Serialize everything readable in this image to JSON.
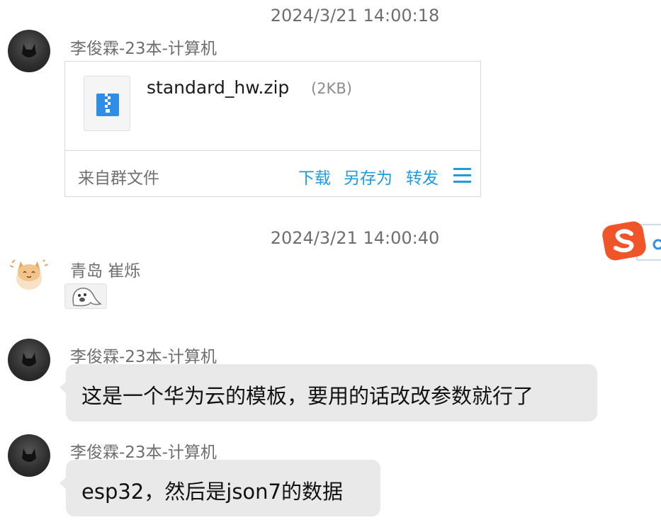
{
  "messages": [
    {
      "timestamp": "2024/3/21 14:00:18",
      "sender": "李俊霖-23本-计算机",
      "file": {
        "name": "standard_hw.zip",
        "size": "(2KB)",
        "source": "来自群文件",
        "actions": [
          "下载",
          "另存为",
          "转发"
        ]
      }
    },
    {
      "timestamp": "2024/3/21 14:00:40",
      "sender": "青岛 崔烁"
    },
    {
      "sender": "李俊霖-23本-计算机",
      "text": "这是一个华为云的模板，要用的话改改参数就行了"
    },
    {
      "sender": "李俊霖-23本-计算机",
      "text": "esp32，然后是json7的数据"
    }
  ],
  "colors": {
    "link": "#1f9cde",
    "bubble_bg": "#e9e9e9",
    "meta_text": "#6e6e6e",
    "ime_orange": "#f0552a"
  },
  "icons": {
    "file": "zip-file-icon",
    "menu": "hamburger-menu-icon",
    "ime": "sogou-ime-icon",
    "sticker": "ghost-sticker"
  }
}
